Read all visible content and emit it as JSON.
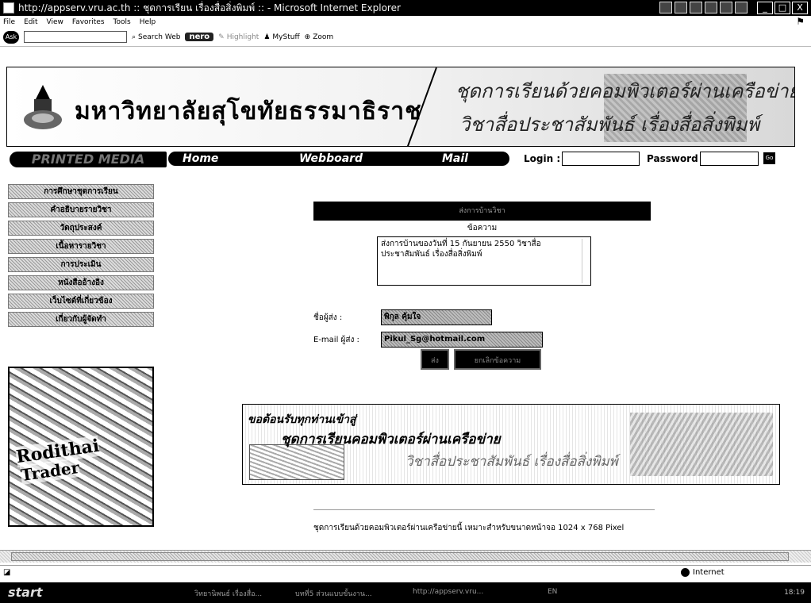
{
  "window": {
    "title": "http://appserv.vru.ac.th :: ชุดการเรียน เรื่องสื่อสิ่งพิมพ์ :: - Microsoft Internet Explorer",
    "minimize": "_",
    "maximize": "□",
    "close": "X"
  },
  "menubar": [
    "File",
    "Edit",
    "View",
    "Favorites",
    "Tools",
    "Help"
  ],
  "toolbar": {
    "ask": "Ask",
    "search_web": "Search Web",
    "nero": "nero",
    "highlight": "Highlight",
    "mystuff": "MyStuff",
    "zoom": "Zoom"
  },
  "banner": {
    "university_name": "มหาวิทยาลัยสุโขทัยธรรมาธิราช",
    "course_line1": "ชุดการเรียนด้วยคอมพิวเตอร์ผ่านเครือข่าย",
    "course_line2": "วิชาสื่อประชาสัมพันธ์ เรื่องสื่อสิ่งพิมพ์"
  },
  "nav": {
    "brand": "PRINTED MEDIA",
    "home": "Home",
    "webboard": "Webboard",
    "mail": "Mail",
    "login_label": "Login :",
    "password_label": "Password :",
    "go": "Go"
  },
  "left_menu": [
    "การศึกษาชุดการเรียน",
    "คำอธิบายรายวิชา",
    "วัตถุประสงค์",
    "เนื้อหารายวิชา",
    "การประเมิน",
    "หนังสืออ้างอิง",
    "เว็บไซต์ที่เกี่ยวข้อง",
    "เกี่ยวกับผู้จัดทำ"
  ],
  "left_image": {
    "mag1": "Rodithai",
    "mag2": "Trader"
  },
  "form": {
    "header": "ส่งการบ้านวิชา",
    "message_label": "ข้อความ",
    "message_value": "ส่งการบ้านของวันที่ 15 กันยายน 2550 วิชาสื่อประชาสัมพันธ์ เรื่องสื่อสิ่งพิมพ์",
    "sender_label": "ชื่อผู้ส่ง :",
    "sender_value": "พิกุล คุ้มใจ",
    "email_label": "E-mail ผู้ส่ง :",
    "email_value": "Pikul_Sg@hotmail.com",
    "send_button": "ส่ง",
    "reset_button": "ยกเลิกข้อความ"
  },
  "welcome": {
    "line1": "ขอต้อนรับทุกท่านเข้าสู่",
    "line2": "ชุดการเรียนคอมพิวเตอร์ผ่านเครือข่าย",
    "line3": "วิชาสื่อประชาสัมพันธ์ เรื่องสื่อสิ่งพิมพ์"
  },
  "footnote": "ชุดการเรียนด้วยคอมพิวเตอร์ผ่านเครือข่ายนี้ เหมาะสำหรับขนาดหน้าจอ 1024 x 768 Pixel",
  "statusbar": {
    "zone": "Internet"
  },
  "taskbar": {
    "start": "start",
    "task1": "วิทยานิพนธ์ เรื่องสื่อ...",
    "task2": "บทที่5 ส่วนแบบขั้นงาน...",
    "task3": "http://appserv.vru...",
    "lang": "EN",
    "clock": "18:19"
  }
}
